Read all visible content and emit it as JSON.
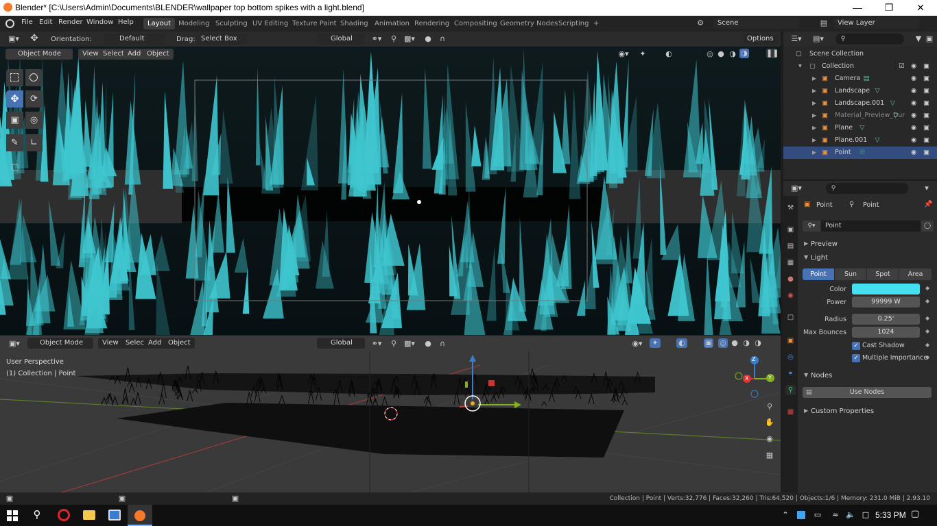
{
  "window": {
    "title": "Blender* [C:\\Users\\Admin\\Documents\\BLENDER\\wallpaper top bottom spikes with a light.blend]"
  },
  "menubar": {
    "menus": [
      "File",
      "Edit",
      "Render",
      "Window",
      "Help"
    ],
    "workspaces": [
      "Layout",
      "Modeling",
      "Sculpting",
      "UV Editing",
      "Texture Paint",
      "Shading",
      "Animation",
      "Rendering",
      "Compositing",
      "Geometry Nodes",
      "Scripting"
    ],
    "active_workspace": "Layout",
    "add_tab": "+",
    "scene": "Scene",
    "view_layer": "View Layer"
  },
  "tool_header": {
    "orientation_label": "Orientation:",
    "orientation_value": "Default",
    "drag_label": "Drag:",
    "drag_value": "Select Box",
    "transform": "Global",
    "options": "Options"
  },
  "viewport_top": {
    "mode": "Object Mode",
    "menus": [
      "View",
      "Select",
      "Add",
      "Object"
    ]
  },
  "viewport_bottom": {
    "mode": "Object Mode",
    "menus": [
      "View",
      "Select",
      "Add",
      "Object"
    ],
    "transform": "Global",
    "overlay_title": "User Perspective",
    "overlay_sub": "(1) Collection | Point",
    "gizmo": {
      "x": "X",
      "y": "Y",
      "z": "Z"
    }
  },
  "outliner": {
    "root": "Scene Collection",
    "collection": "Collection",
    "items": [
      {
        "name": "Camera",
        "type": "camera"
      },
      {
        "name": "Landscape",
        "type": "mesh"
      },
      {
        "name": "Landscape.001",
        "type": "mesh"
      },
      {
        "name": "Material_Preview_Dur",
        "type": "mesh",
        "dim": true
      },
      {
        "name": "Plane",
        "type": "mesh"
      },
      {
        "name": "Plane.001",
        "type": "mesh"
      },
      {
        "name": "Point",
        "type": "light",
        "selected": true
      }
    ]
  },
  "properties": {
    "object_name": "Point",
    "data_name": "Point",
    "datablock": "Point",
    "preview": "Preview",
    "light_panel": "Light",
    "light_types": [
      "Point",
      "Sun",
      "Spot",
      "Area"
    ],
    "active_light_type": "Point",
    "color_label": "Color",
    "color_value": "#45e0ef",
    "power_label": "Power",
    "power_value": "99999 W",
    "radius_label": "Radius",
    "radius_value": "0.25'",
    "max_bounces_label": "Max Bounces",
    "max_bounces_value": "1024",
    "cast_shadow": "Cast Shadow",
    "multiple_importance": "Multiple Importance",
    "nodes_panel": "Nodes",
    "use_nodes": "Use Nodes",
    "custom_properties": "Custom Properties"
  },
  "statusbar": {
    "stats": "Collection | Point | Verts:32,776 | Faces:32,260 | Tris:64,520 | Objects:1/6 | Memory: 231.0 MiB | 2.93.10"
  },
  "taskbar": {
    "time": "5:33 PM"
  },
  "colors": {
    "spike": "#3fc6cf",
    "accent": "#4772b3",
    "selected_row": "#334d80"
  }
}
